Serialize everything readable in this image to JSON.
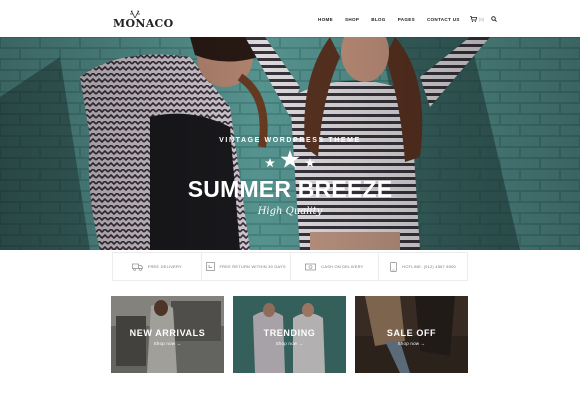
{
  "header": {
    "logo": "MONACO",
    "nav": [
      "HOME",
      "SHOP",
      "BLOG",
      "PAGES",
      "CONTACT US"
    ],
    "cart_count": "(0)"
  },
  "hero": {
    "tagline": "VINTAGE WORDPRESS THEME",
    "title": "SUMMER BREEZE",
    "subtitle": "High Quality"
  },
  "features": [
    {
      "icon": "truck-icon",
      "label": "FREE DELIVERY"
    },
    {
      "icon": "return-box-icon",
      "label": "FREE RETURN WITHIN 30 DAYS"
    },
    {
      "icon": "cash-icon",
      "label": "CASH ON DELIVERY"
    },
    {
      "icon": "phone-icon",
      "label": "HOTLINE: (012) 4567 8900"
    }
  ],
  "promos": [
    {
      "title": "NEW ARRIVALS",
      "link": "Shop now →"
    },
    {
      "title": "TRENDING",
      "link": "Shop now →"
    },
    {
      "title": "SALE OFF",
      "link": "Shop now →"
    }
  ]
}
